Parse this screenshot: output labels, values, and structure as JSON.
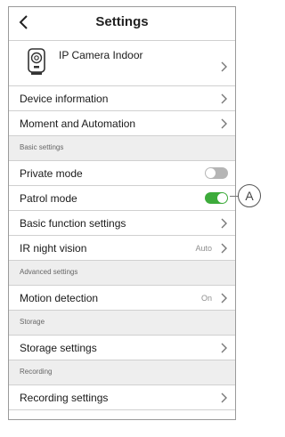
{
  "header": {
    "title": "Settings"
  },
  "device": {
    "name": "IP Camera Indoor"
  },
  "rows": {
    "device_info": "Device information",
    "moment_automation": "Moment and Automation",
    "private_mode": "Private mode",
    "patrol_mode": "Patrol mode",
    "basic_function": "Basic function settings",
    "ir_night_vision": "IR night vision",
    "ir_night_vision_value": "Auto",
    "motion_detection": "Motion detection",
    "motion_detection_value": "On",
    "storage_settings": "Storage settings",
    "recording_settings": "Recording settings"
  },
  "toggles": {
    "private_mode": false,
    "patrol_mode": true
  },
  "sections": {
    "basic": "Basic settings",
    "advanced": "Advanced settings",
    "storage": "Storage",
    "recording": "Recording"
  },
  "callout": {
    "label": "A"
  },
  "colors": {
    "toggle_on": "#3dab3b",
    "toggle_off": "#b5b5b5"
  }
}
